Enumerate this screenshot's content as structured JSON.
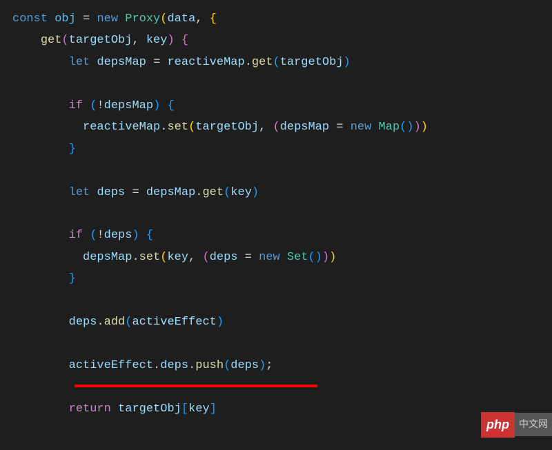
{
  "code": {
    "l1_const": "const",
    "l1_obj": "obj",
    "l1_eq": " = ",
    "l1_new": "new",
    "l1_proxy": "Proxy",
    "l1_data": "data",
    "l2_get": "get",
    "l2_targetObj": "targetObj",
    "l2_key": "key",
    "l3_let": "let",
    "l3_depsMap": "depsMap",
    "l3_reactiveMap": "reactiveMap",
    "l3_getfn": "get",
    "l3_targetObj": "targetObj",
    "l4_if": "if",
    "l4_depsMap": "depsMap",
    "l5_reactiveMap": "reactiveMap",
    "l5_set": "set",
    "l5_targetObj": "targetObj",
    "l5_depsMap": "depsMap",
    "l5_new": "new",
    "l5_Map": "Map",
    "l6_let": "let",
    "l6_deps": "deps",
    "l6_depsMap": "depsMap",
    "l6_get": "get",
    "l6_key": "key",
    "l7_if": "if",
    "l7_deps": "deps",
    "l8_depsMap": "depsMap",
    "l8_set": "set",
    "l8_key": "key",
    "l8_deps": "deps",
    "l8_new": "new",
    "l8_Set": "Set",
    "l9_deps": "deps",
    "l9_add": "add",
    "l9_activeEffect": "activeEffect",
    "l10_activeEffect": "activeEffect",
    "l10_depsprop": "deps",
    "l10_push": "push",
    "l10_deps": "deps",
    "l11_return": "return",
    "l11_targetObj": "targetObj",
    "l11_key": "key"
  },
  "watermark": {
    "php": "php",
    "cn": "中文网"
  }
}
